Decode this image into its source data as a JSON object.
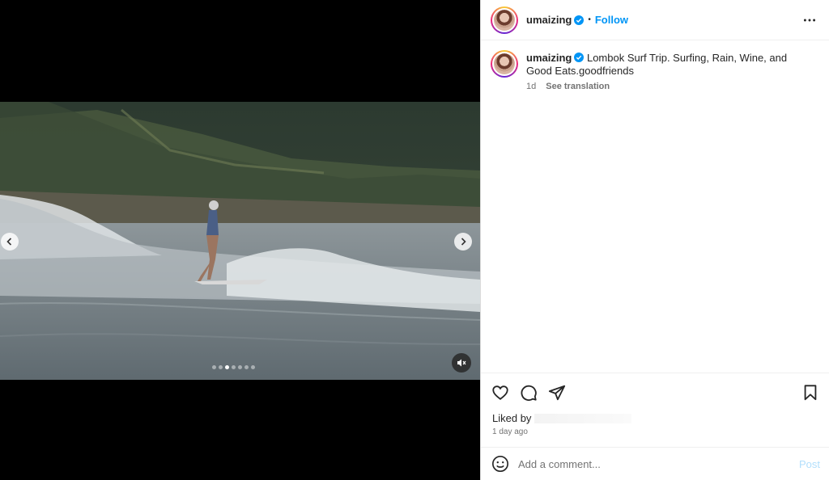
{
  "post": {
    "username": "umaizing",
    "follow_label": "Follow",
    "separator": "•",
    "caption": "Lombok Surf Trip. Surfing, Rain, Wine, and Good Eats.goodfriends",
    "age": "1d",
    "see_translation": "See translation",
    "liked_by_label": "Liked by",
    "timestamp": "1 day ago"
  },
  "carousel": {
    "slide_count": 7,
    "active_index": 2
  },
  "comment": {
    "placeholder": "Add a comment...",
    "post_label": "Post"
  },
  "icons": {
    "header_more": "more-horizontal-icon",
    "like": "heart-icon",
    "comment": "comment-bubble-icon",
    "share": "paper-plane-icon",
    "save": "bookmark-icon",
    "emoji": "smiley-icon",
    "verified": "verified-badge-icon",
    "mute": "speaker-muted-icon"
  },
  "colors": {
    "accent": "#0095f6",
    "post_disabled": "#b2dffc"
  }
}
